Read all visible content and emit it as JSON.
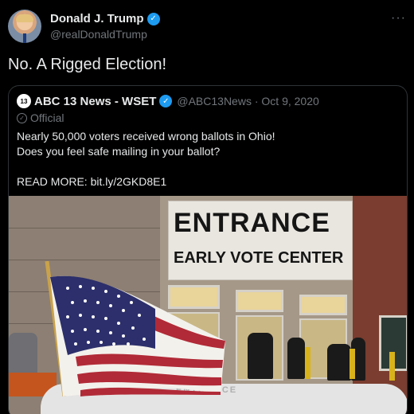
{
  "tweet": {
    "author_name": "Donald J. Trump",
    "handle": "@realDonaldTrump",
    "more_icon": "more-horizontal-icon",
    "text": "No. A Rigged Election!"
  },
  "quoted": {
    "logo_text": "13",
    "name": "ABC 13 News - WSET",
    "handle_date": "@ABC13News · Oct 9, 2020",
    "label": "Official",
    "lines": [
      "Nearly 50,000 voters received wrong ballots in Ohio!",
      "Does you feel safe mailing in your ballot?",
      "READ MORE: bit.ly/2GKD8E1"
    ],
    "photo": {
      "banner_line1": "ENTRANCE",
      "banner_line2": "EARLY VOTE CENTER",
      "car_text": "ENTRANCE"
    }
  },
  "colors": {
    "background": "#000000",
    "verified": "#1d9bf0",
    "muted": "#71767b"
  }
}
